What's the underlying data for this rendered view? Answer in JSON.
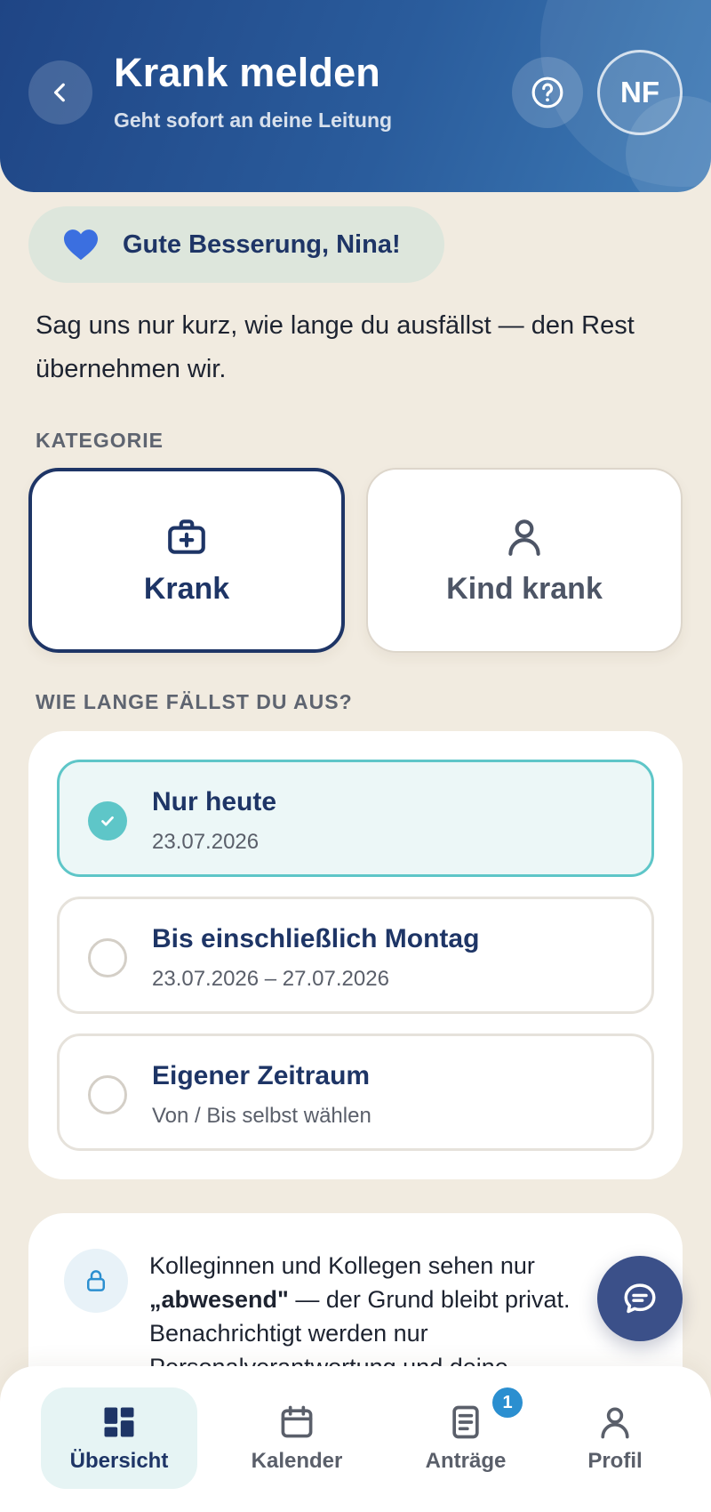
{
  "header": {
    "title": "Krank melden",
    "subtitle": "Geht sofort an deine Leitung",
    "avatar_initials": "NF",
    "icons": {
      "back": "chevron-left-icon",
      "help": "question-circle-icon"
    }
  },
  "greeting": {
    "text": "Gute Besserung, Nina!",
    "icon": "heart-icon",
    "icon_color": "#3b6fe0"
  },
  "intro": {
    "text": "Sag uns nur kurz, wie lange du ausfällst — den Rest übernehmen wir."
  },
  "category": {
    "label": "KATEGORIE",
    "options": [
      {
        "label": "Krank",
        "icon": "medical-kit-icon",
        "selected": true
      },
      {
        "label": "Kind krank",
        "icon": "person-icon",
        "selected": false
      }
    ]
  },
  "duration": {
    "label": "WIE LANGE FÄLLST DU AUS?",
    "options": [
      {
        "title": "Nur heute",
        "subtitle": "23.07.2026",
        "selected": true
      },
      {
        "title": "Bis einschließlich Montag",
        "subtitle": "23.07.2026 – 27.07.2026",
        "selected": false
      },
      {
        "title": "Eigener Zeitraum",
        "subtitle": "Von / Bis selbst wählen",
        "selected": false
      }
    ]
  },
  "privacy": {
    "icon": "lock-icon",
    "line1": "Kolleginnen und Kollegen sehen nur",
    "line2_bold": "„abwesend\"",
    "line2_rest": " — der Grund bleibt privat.",
    "line3": "Benachrichtigt werden nur",
    "line4": "Personalverantwortung und deine"
  },
  "chat": {
    "icon": "chat-bubble-icon"
  },
  "nav": {
    "items": [
      {
        "label": "Übersicht",
        "icon": "dashboard-icon",
        "active": true
      },
      {
        "label": "Kalender",
        "icon": "calendar-icon",
        "active": false
      },
      {
        "label": "Anträge",
        "icon": "document-icon",
        "active": false,
        "badge": "1"
      },
      {
        "label": "Profil",
        "icon": "person-icon",
        "active": false
      }
    ]
  },
  "colors": {
    "primary": "#1e3566",
    "accent_teal": "#5ec6c8",
    "background": "#f1ebe0",
    "badge": "#2b8fd0"
  }
}
